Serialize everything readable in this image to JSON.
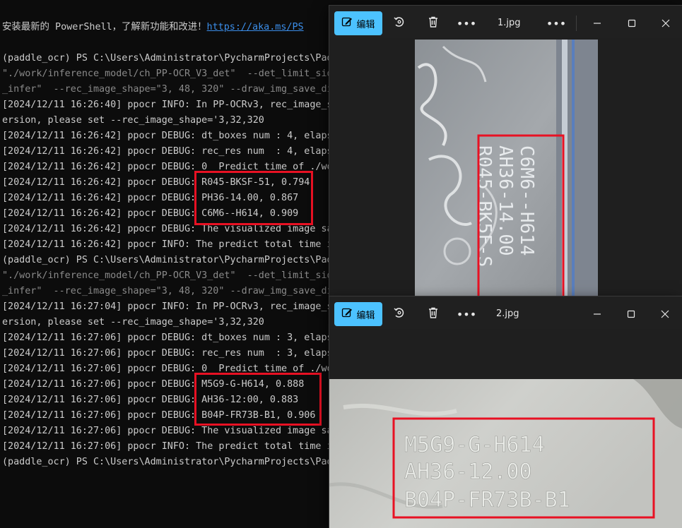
{
  "terminal": {
    "lines": [
      {
        "text": "安装最新的 PowerShell，了解新功能和改进！",
        "link": "https://aka.ms/PS"
      },
      {
        "text": ""
      },
      {
        "text": "(paddle_ocr) PS C:\\Users\\Administrator\\PycharmProjects\\Pad"
      },
      {
        "text": "\"./work/inference_model/ch_PP-OCR_V3_det\"  --det_limit_sid",
        "dim": true
      },
      {
        "text": "_infer\"  --rec_image_shape=\"3, 48, 320\" --draw_img_save_di",
        "dim": true
      },
      {
        "text": "[2024/12/11 16:26:40] ppocr INFO: In PP-OCRv3, rec_image_s"
      },
      {
        "text": "ersion, please set --rec_image_shape='3,32,320"
      },
      {
        "text": "[2024/12/11 16:26:42] ppocr DEBUG: dt_boxes num : 4, elaps"
      },
      {
        "text": "[2024/12/11 16:26:42] ppocr DEBUG: rec_res num  : 4, elaps"
      },
      {
        "text": "[2024/12/11 16:26:42] ppocr DEBUG: 0  Predict time of ./wo"
      },
      {
        "text": "[2024/12/11 16:26:42] ppocr DEBUG: R045-BKSF-51, 0.794"
      },
      {
        "text": "[2024/12/11 16:26:42] ppocr DEBUG: PH36-14.00, 0.867"
      },
      {
        "text": "[2024/12/11 16:26:42] ppocr DEBUG: C6M6--H614, 0.909"
      },
      {
        "text": "[2024/12/11 16:26:42] ppocr DEBUG: The visualized image sa"
      },
      {
        "text": "[2024/12/11 16:26:42] ppocr INFO: The predict total time i"
      },
      {
        "text": "(paddle_ocr) PS C:\\Users\\Administrator\\PycharmProjects\\Pad"
      },
      {
        "text": "\"./work/inference_model/ch_PP-OCR_V3_det\"  --det_limit_sid",
        "dim": true
      },
      {
        "text": "_infer\"  --rec_image_shape=\"3, 48, 320\" --draw_img_save_di",
        "dim": true
      },
      {
        "text": "[2024/12/11 16:27:04] ppocr INFO: In PP-OCRv3, rec_image_s"
      },
      {
        "text": "ersion, please set --rec_image_shape='3,32,320"
      },
      {
        "text": "[2024/12/11 16:27:06] ppocr DEBUG: dt_boxes num : 3, elaps"
      },
      {
        "text": "[2024/12/11 16:27:06] ppocr DEBUG: rec_res num  : 3, elaps"
      },
      {
        "text": "[2024/12/11 16:27:06] ppocr DEBUG: 0  Predict time of ./wo"
      },
      {
        "text": "[2024/12/11 16:27:06] ppocr DEBUG: M5G9-G-H614, 0.888"
      },
      {
        "text": "[2024/12/11 16:27:06] ppocr DEBUG: AH36-12:00, 0.883"
      },
      {
        "text": "[2024/12/11 16:27:06] ppocr DEBUG: B04P-FR73B-B1, 0.906"
      },
      {
        "text": "[2024/12/11 16:27:06] ppocr DEBUG: The visualized image sa"
      },
      {
        "text": "[2024/12/11 16:27:06] ppocr INFO: The predict total time i"
      },
      {
        "text": "(paddle_ocr) PS C:\\Users\\Administrator\\PycharmProjects\\Pad"
      }
    ]
  },
  "viewer1": {
    "edit_label": "编辑",
    "title": "1.jpg",
    "photo_text": [
      "C6M6--H614",
      "AH36-14.00",
      "R045-BK5F-S"
    ]
  },
  "viewer2": {
    "edit_label": "编辑",
    "title": "2.jpg",
    "photo_text": [
      "M5G9-G-H614",
      "AH36-12.00",
      "B04P-FR73B-B1"
    ]
  },
  "colors": {
    "accent": "#4cc2ff",
    "highlight": "#e81123",
    "terminal_bg": "#0c0c0c",
    "terminal_fg": "#cccccc",
    "link": "#3b8eea"
  }
}
